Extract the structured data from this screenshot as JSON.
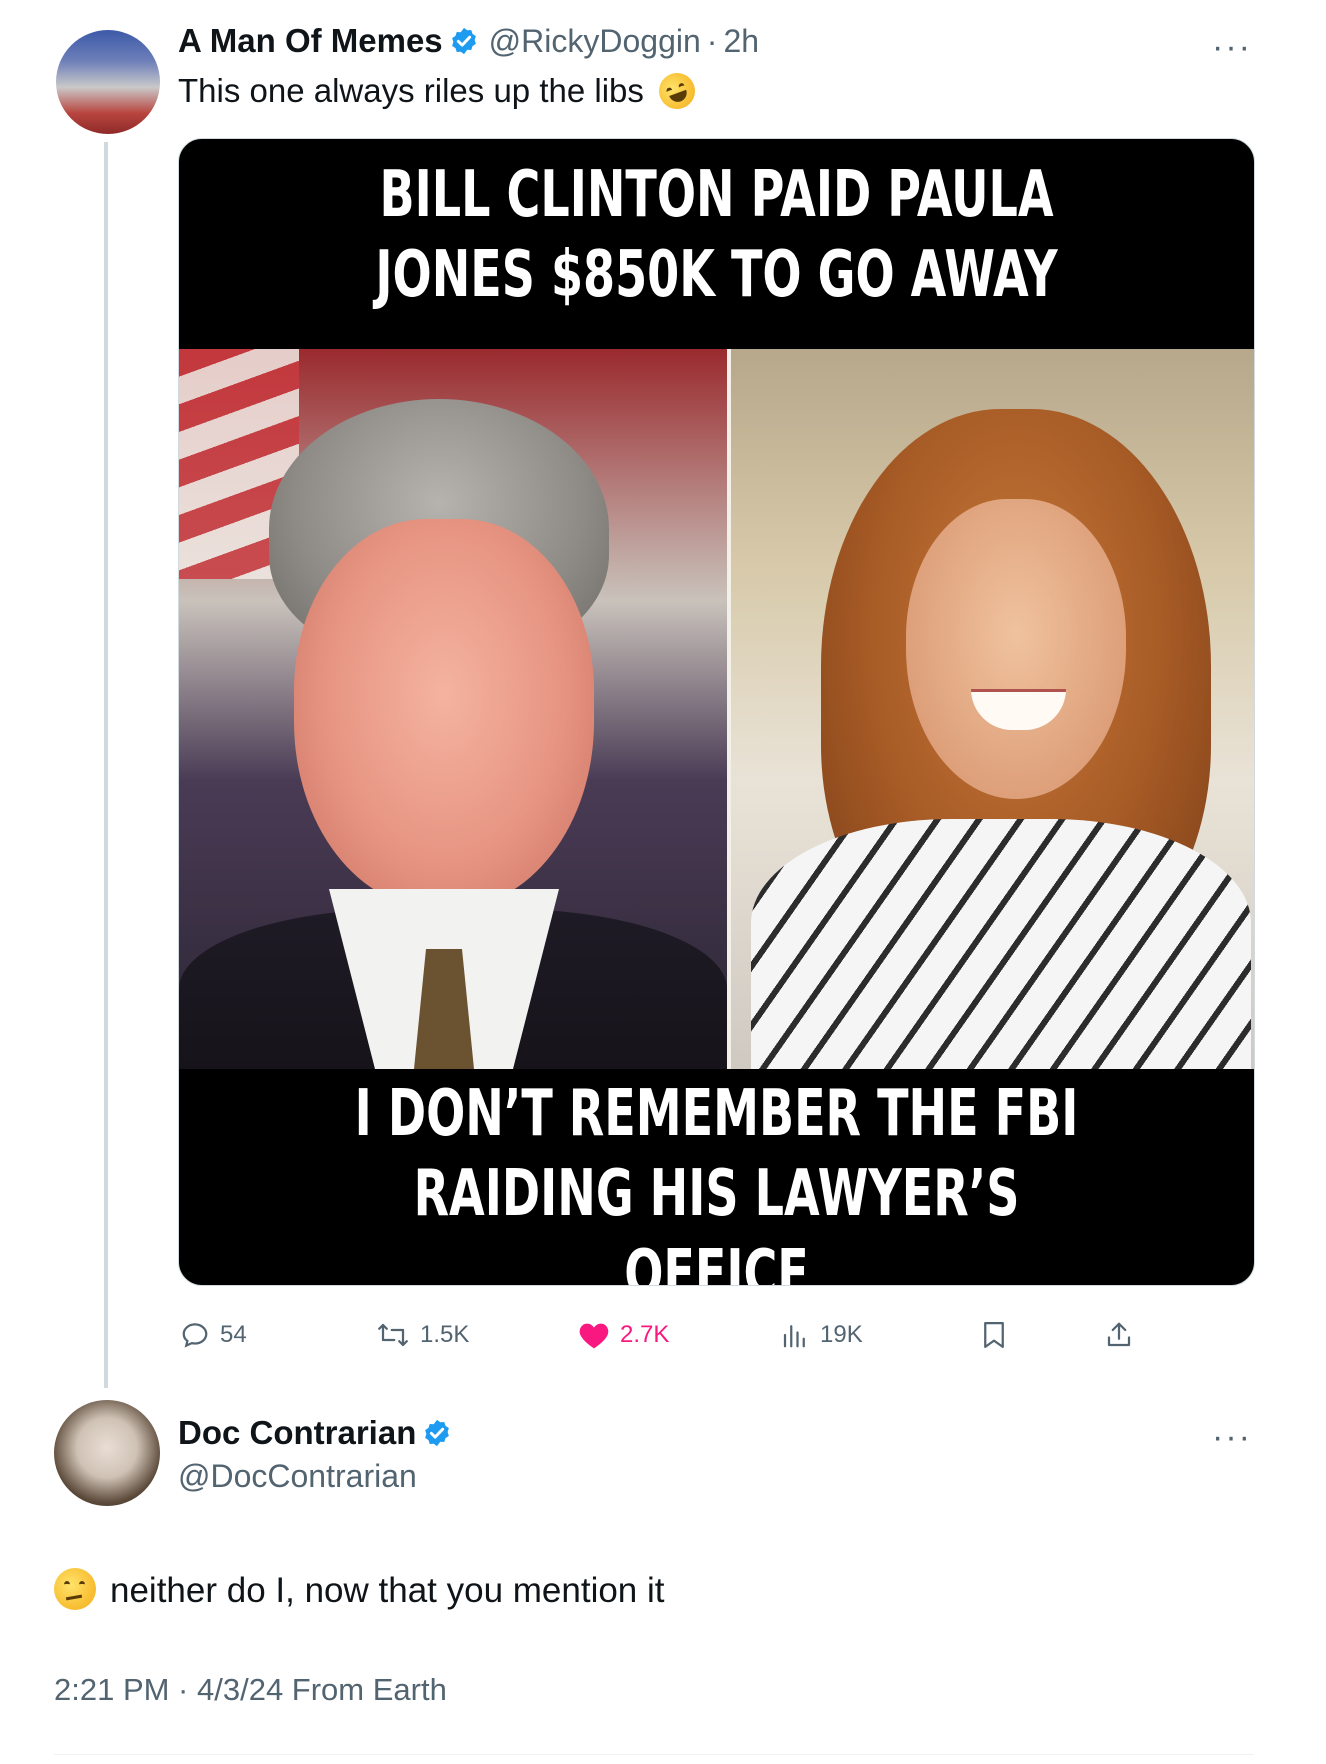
{
  "tweet": {
    "author_name": "A Man Of Memes",
    "handle": "@RickyDoggin",
    "separator": "·",
    "time_ago": "2h",
    "text": "This one always riles up the libs",
    "emoji": "rolling-on-floor-laughing-emoji",
    "meme": {
      "top_caption": "BILL CLINTON PAID PAULA JONES $850K TO GO AWAY",
      "bottom_caption": "I DON’T REMEMBER THE FBI RAIDING HIS LAWYER’S OFFICE"
    },
    "actions": {
      "replies": "54",
      "reposts": "1.5K",
      "likes": "2.7K",
      "views": "19K"
    }
  },
  "reply": {
    "author_name": "Doc Contrarian",
    "handle": "@DocContrarian",
    "text": "neither do I, now that you mention it",
    "emoji": "thinking-face-emoji",
    "timestamp": "2:21 PM · 4/3/24 From Earth"
  },
  "more_label": "···",
  "colors": {
    "text": "#0f1419",
    "secondary": "#536471",
    "verified": "#1d9bf0",
    "like": "#f91880",
    "border": "#cfd9de"
  }
}
